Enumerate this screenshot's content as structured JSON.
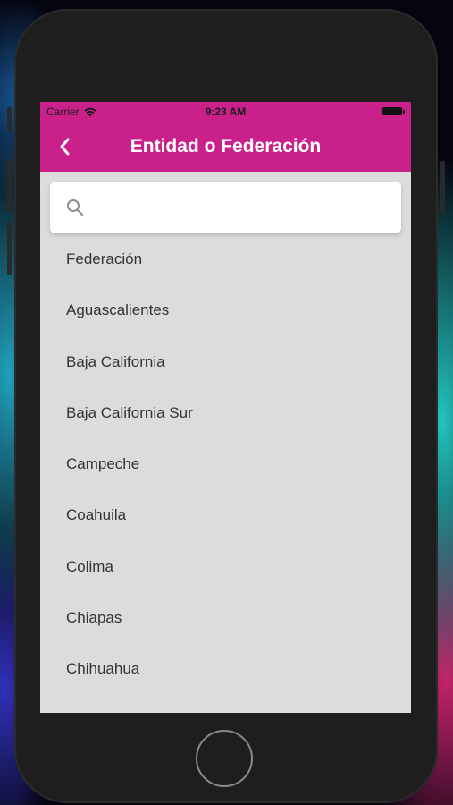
{
  "status_bar": {
    "carrier": "Carrier",
    "time": "9:23 AM"
  },
  "nav": {
    "title": "Entidad o Federación",
    "back_icon": "chevron-left-icon"
  },
  "search": {
    "value": "",
    "placeholder": "",
    "icon": "search-icon"
  },
  "states": [
    {
      "label": "Federación"
    },
    {
      "label": "Aguascalientes"
    },
    {
      "label": "Baja California"
    },
    {
      "label": "Baja California Sur"
    },
    {
      "label": "Campeche"
    },
    {
      "label": "Coahuila"
    },
    {
      "label": "Colima"
    },
    {
      "label": "Chiapas"
    },
    {
      "label": "Chihuahua"
    }
  ],
  "colors": {
    "accent": "#c9208a",
    "list_background": "#dcdcdc",
    "text": "#333333"
  }
}
